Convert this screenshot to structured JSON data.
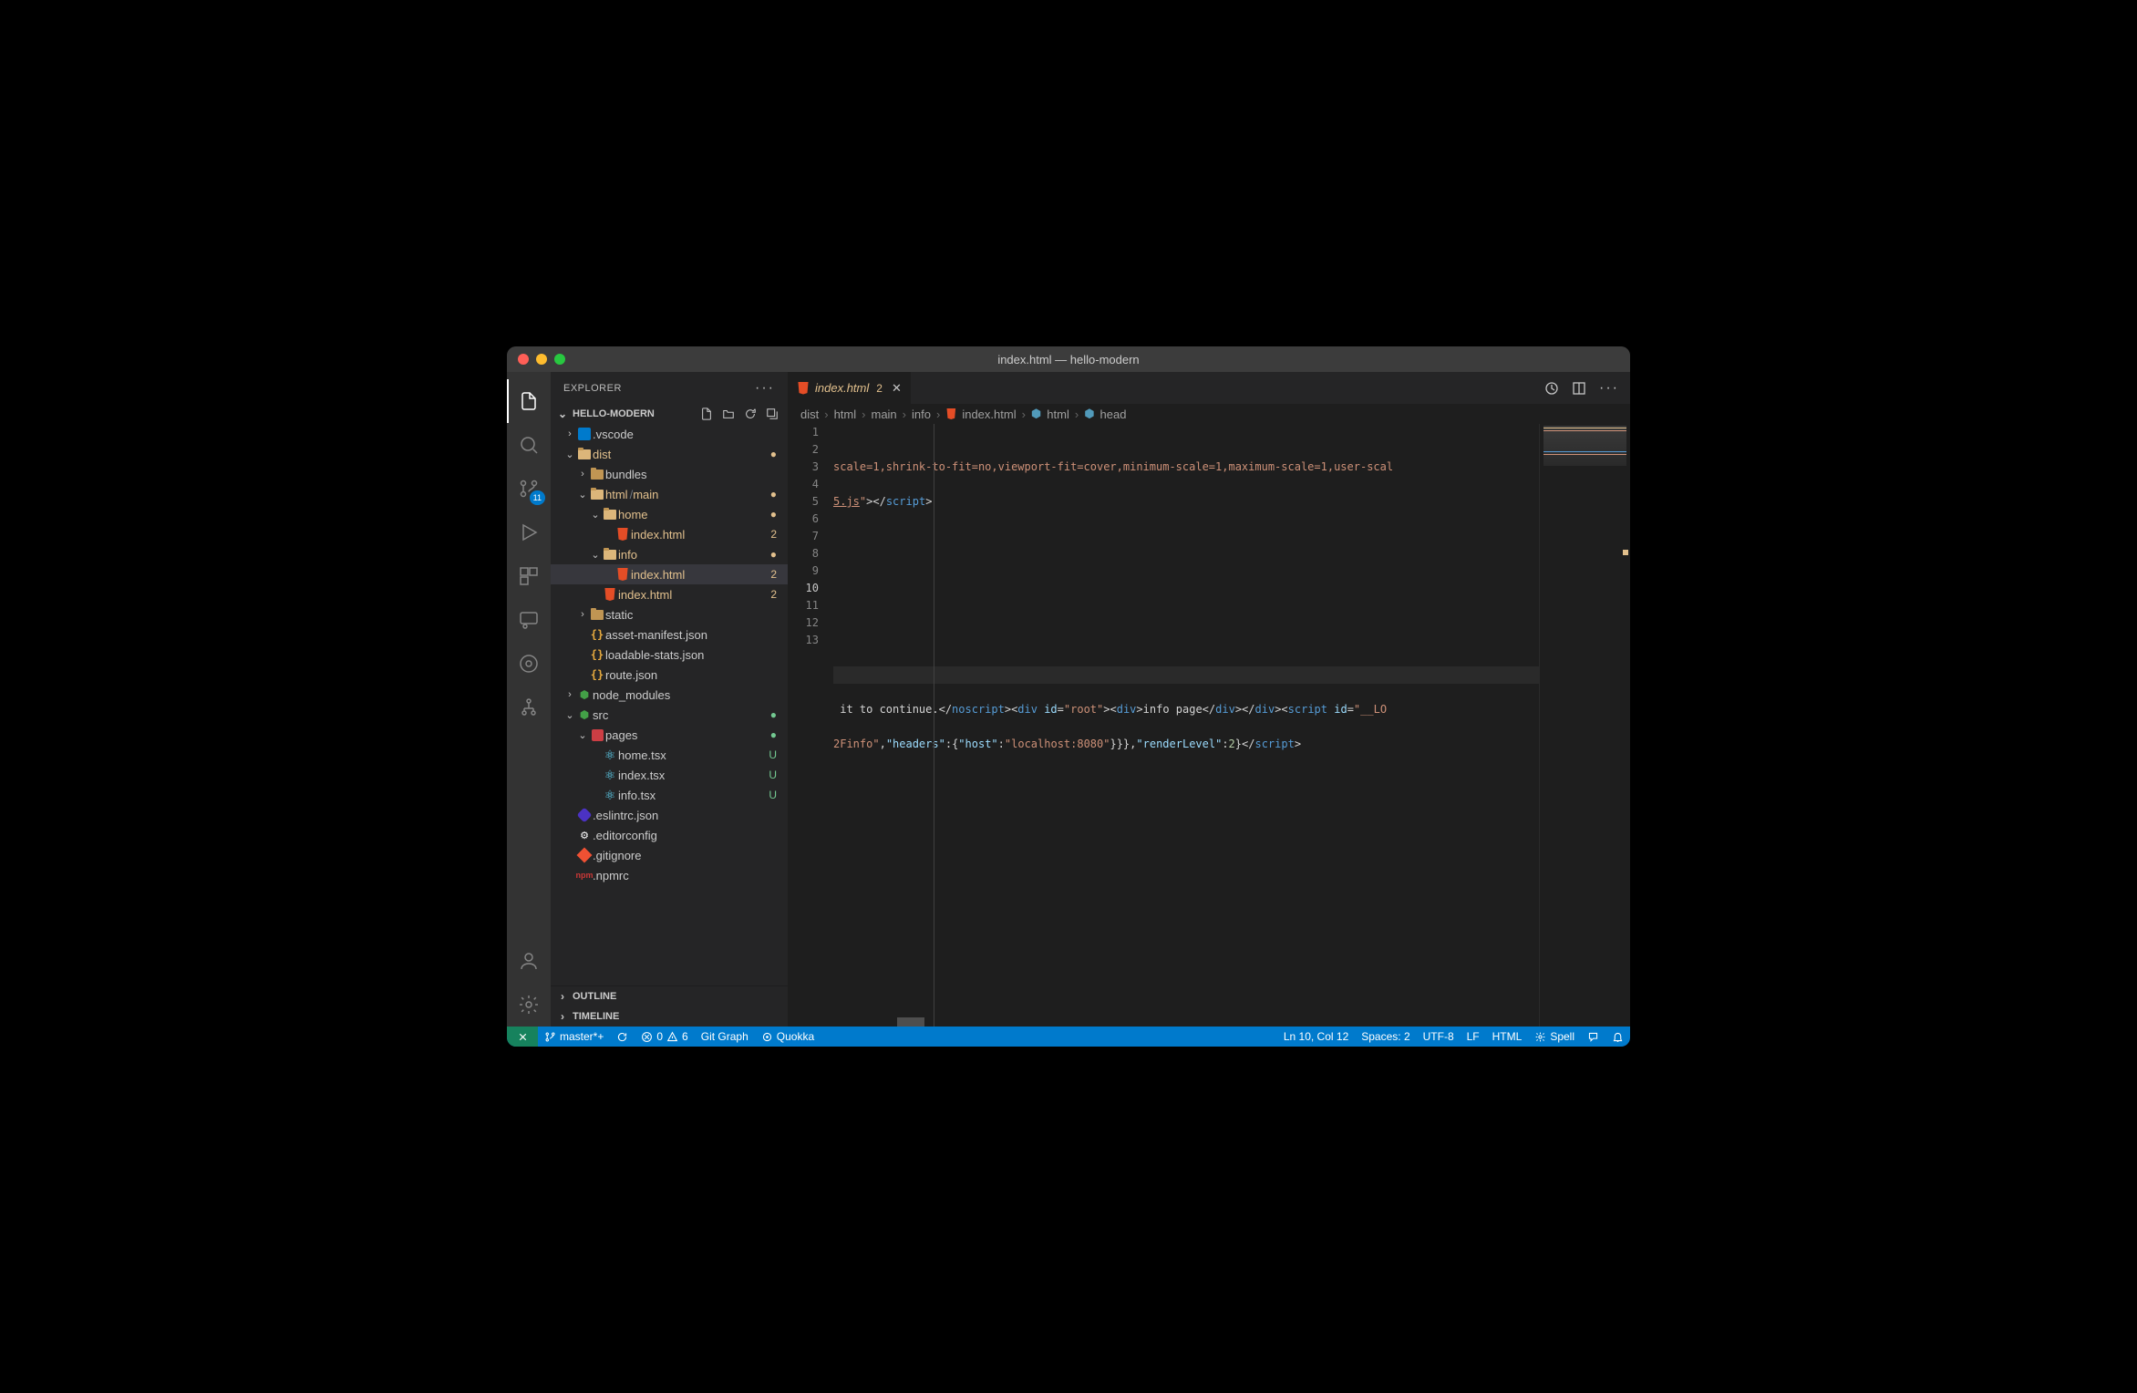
{
  "window_title": "index.html — hello-modern",
  "sidebar": {
    "title": "EXPLORER",
    "project": "HELLO-MODERN",
    "outline": "OUTLINE",
    "timeline": "TIMELINE"
  },
  "tree": {
    "vscode": ".vscode",
    "dist": "dist",
    "bundles": "bundles",
    "html": "html",
    "main": "main",
    "home": "home",
    "home_index": "index.html",
    "home_badge": "2",
    "info": "info",
    "info_index": "index.html",
    "info_badge": "2",
    "main_index": "index.html",
    "main_badge": "2",
    "static": "static",
    "asset_manifest": "asset-manifest.json",
    "loadable_stats": "loadable-stats.json",
    "route_json": "route.json",
    "node_modules": "node_modules",
    "src": "src",
    "pages": "pages",
    "home_tsx": "home.tsx",
    "index_tsx": "index.tsx",
    "info_tsx": "info.tsx",
    "eslintrc": ".eslintrc.json",
    "editorconfig": ".editorconfig",
    "gitignore": ".gitignore",
    "npmrc": ".npmrc",
    "u": "U"
  },
  "tab": {
    "name": "index.html",
    "badge": "2"
  },
  "breadcrumb": {
    "dist": "dist",
    "html": "html",
    "main": "main",
    "info": "info",
    "file": "index.html",
    "html_el": "html",
    "head": "head"
  },
  "lines": [
    "1",
    "2",
    "3",
    "4",
    "5",
    "6",
    "7",
    "8",
    "9",
    "10",
    "11",
    "12",
    "13"
  ],
  "code": {
    "l1a": "scale=1,shrink-to-fit=no,viewport-fit=cover,minimum-scale=1,maximum-scale=1,user-scal",
    "l2a": "5.js",
    "l2b": "\"",
    "l2c": "></",
    "l2d": "script",
    "l2e": ">",
    "l11a": " it to continue.",
    "l11b": "</",
    "l11c": "noscript",
    "l11d": "><",
    "l11e": "div",
    "l11f": " id",
    "l11g": "=",
    "l11h": "\"root\"",
    "l11i": "><",
    "l11j": "div",
    "l11k": ">",
    "l11l": "info page",
    "l11m": "</",
    "l11n": "div",
    "l11o": "></",
    "l11p": "div",
    "l11q": "><",
    "l11r": "script",
    "l11s": " id",
    "l11t": "=",
    "l11u": "\"__LO",
    "l12a": "2Finfo\"",
    "l12b": ",",
    "l12c": "\"headers\"",
    "l12d": ":{",
    "l12e": "\"host\"",
    "l12f": ":",
    "l12g": "\"localhost:8080\"",
    "l12h": "}}},",
    "l12i": "\"renderLevel\"",
    "l12j": ":",
    "l12k": "2",
    "l12l": "}",
    "l12m": "</",
    "l12n": "script",
    "l12o": ">"
  },
  "status": {
    "branch": "master*+",
    "errors": "0",
    "warnings": "6",
    "gitgraph": "Git Graph",
    "quokka": "Quokka",
    "cursor": "Ln 10, Col 12",
    "spaces": "Spaces: 2",
    "encoding": "UTF-8",
    "eol": "LF",
    "lang": "HTML",
    "spell": "Spell"
  },
  "scm_badge": "11"
}
